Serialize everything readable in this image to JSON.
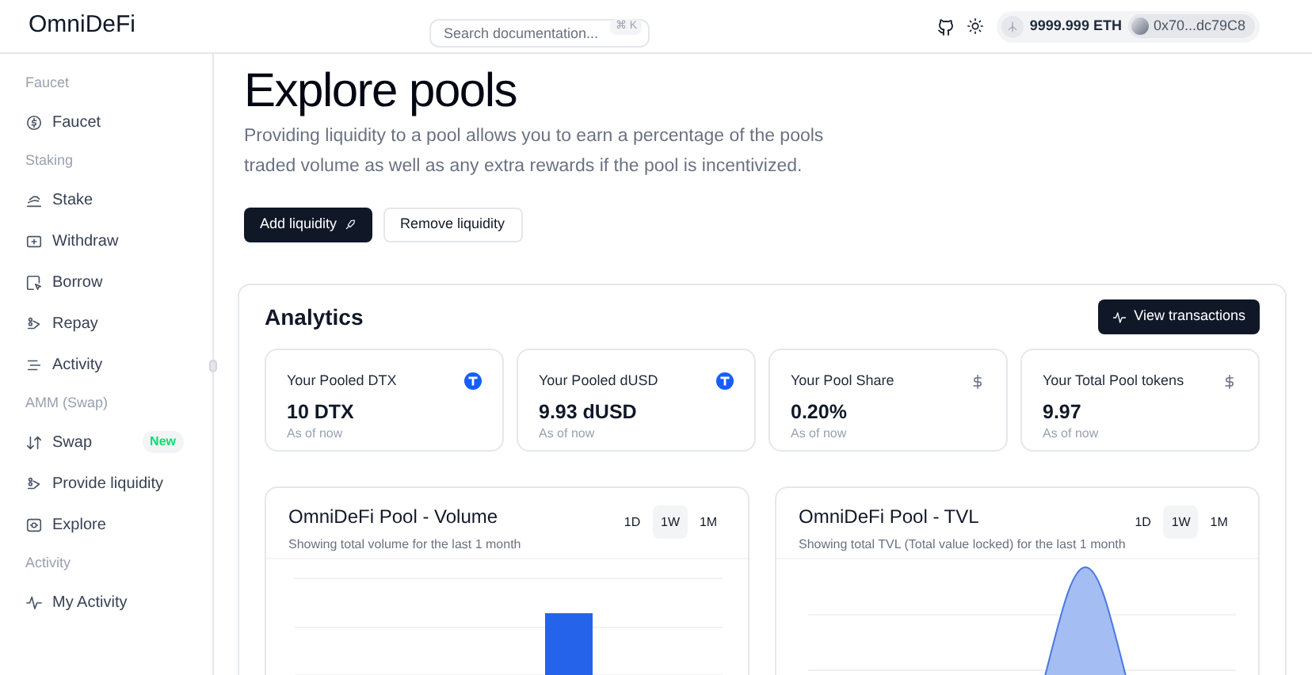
{
  "header": {
    "logo": "OmniDeFi",
    "search": {
      "placeholder": "Search documentation...",
      "shortcut": "⌘ K"
    },
    "balance": "9999.999 ETH",
    "address": "0x70...dc79C8"
  },
  "sidebar": {
    "sections": [
      {
        "label": "Faucet",
        "items": [
          {
            "label": "Faucet"
          }
        ]
      },
      {
        "label": "Staking",
        "items": [
          {
            "label": "Stake"
          },
          {
            "label": "Withdraw"
          },
          {
            "label": "Borrow"
          },
          {
            "label": "Repay"
          },
          {
            "label": "Activity"
          }
        ]
      },
      {
        "label": "AMM (Swap)",
        "items": [
          {
            "label": "Swap",
            "badge": "New"
          },
          {
            "label": "Provide liquidity"
          },
          {
            "label": "Explore"
          }
        ]
      },
      {
        "label": "Activity",
        "items": [
          {
            "label": "My Activity"
          }
        ]
      }
    ]
  },
  "page": {
    "title": "Explore pools",
    "description": "Providing liquidity to a pool allows you to earn a percentage of the pools traded volume as well as any extra rewards if the pool is incentivized.",
    "buttons": [
      {
        "label": "Add liquidity",
        "kind": "primary"
      },
      {
        "label": "Remove liquidity",
        "kind": "secondary"
      }
    ]
  },
  "analytics": {
    "title": "Analytics",
    "button": "View transactions",
    "stats": [
      {
        "label": "Your Pooled DTX",
        "value": "10 DTX",
        "note": "As of now",
        "kind": "token"
      },
      {
        "label": "Your Pooled dUSD",
        "value": "9.93 dUSD",
        "note": "As of now",
        "kind": "token"
      },
      {
        "label": "Your Pool Share",
        "value": "0.20%",
        "note": "As of now",
        "kind": "dollar"
      },
      {
        "label": "Your Total Pool tokens",
        "value": "9.97",
        "note": "As of now",
        "kind": "dollar"
      }
    ],
    "charts": [
      {
        "title": "OmniDeFi Pool - Volume",
        "subtitle": "Showing total volume for the last 1 month",
        "kind": "bar",
        "ranges": [
          {
            "label": "1D",
            "selected": false
          },
          {
            "label": "1W",
            "selected": true
          },
          {
            "label": "1M",
            "selected": false
          }
        ]
      },
      {
        "title": "OmniDeFi Pool - TVL",
        "subtitle": "Showing total TVL (Total value locked) for the last 1 month",
        "kind": "area",
        "ranges": [
          {
            "label": "1D",
            "selected": false
          },
          {
            "label": "1W",
            "selected": true
          },
          {
            "label": "1M",
            "selected": false
          }
        ]
      }
    ]
  }
}
